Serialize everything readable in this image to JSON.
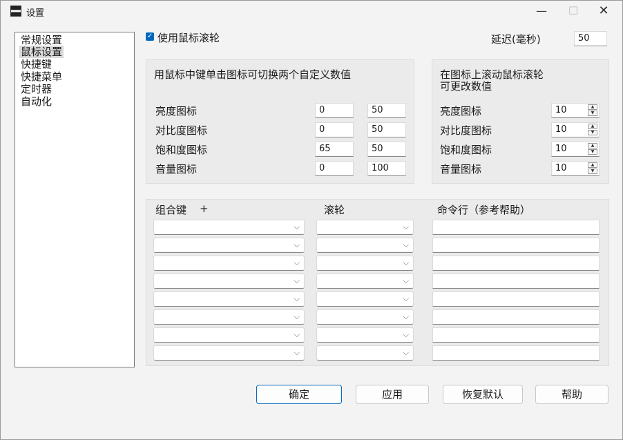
{
  "window": {
    "title": "设置"
  },
  "window_controls": {
    "minimize": "—",
    "maximize": "☐",
    "close": "✕"
  },
  "nav": {
    "items": [
      "常规设置",
      "鼠标设置",
      "快捷键",
      "快捷菜单",
      "定时器",
      "自动化"
    ],
    "selected": "鼠标设置"
  },
  "use_wheel": {
    "label": "使用鼠标滚轮",
    "checked": true
  },
  "delay": {
    "label": "延迟(毫秒)",
    "value": "50"
  },
  "middle_click": {
    "heading": "用鼠标中键单击图标可切换两个自定义数值",
    "rows": [
      {
        "label": "亮度图标",
        "value1": "0",
        "value2": "50"
      },
      {
        "label": "对比度图标",
        "value1": "0",
        "value2": "50"
      },
      {
        "label": "饱和度图标",
        "value1": "65",
        "value2": "50"
      },
      {
        "label": "音量图标",
        "value1": "0",
        "value2": "100"
      }
    ]
  },
  "scroll": {
    "heading_line1": "在图标上滚动鼠标滚轮",
    "heading_line2": "可更改数值",
    "rows": [
      {
        "label": "亮度图标",
        "value": "10"
      },
      {
        "label": "对比度图标",
        "value": "10"
      },
      {
        "label": "饱和度图标",
        "value": "10"
      },
      {
        "label": "音量图标",
        "value": "10"
      }
    ]
  },
  "bindings": {
    "col_combo": "组合键",
    "col_plus": "+",
    "col_wheel": "滚轮",
    "col_cmd": "命令行（参考帮助）",
    "rows": [
      {
        "combo": "",
        "wheel": "",
        "command": ""
      },
      {
        "combo": "",
        "wheel": "",
        "command": ""
      },
      {
        "combo": "",
        "wheel": "",
        "command": ""
      },
      {
        "combo": "",
        "wheel": "",
        "command": ""
      },
      {
        "combo": "",
        "wheel": "",
        "command": ""
      },
      {
        "combo": "",
        "wheel": "",
        "command": ""
      },
      {
        "combo": "",
        "wheel": "",
        "command": ""
      },
      {
        "combo": "",
        "wheel": "",
        "command": ""
      }
    ]
  },
  "buttons": {
    "ok": "确定",
    "apply": "应用",
    "reset": "恢复默认",
    "help": "帮助"
  },
  "icons": {
    "checkbox_check": "✓",
    "chevron": "⌵",
    "spin_up": "▲",
    "spin_down": "▼"
  },
  "colors": {
    "accent": "#0067c0"
  }
}
